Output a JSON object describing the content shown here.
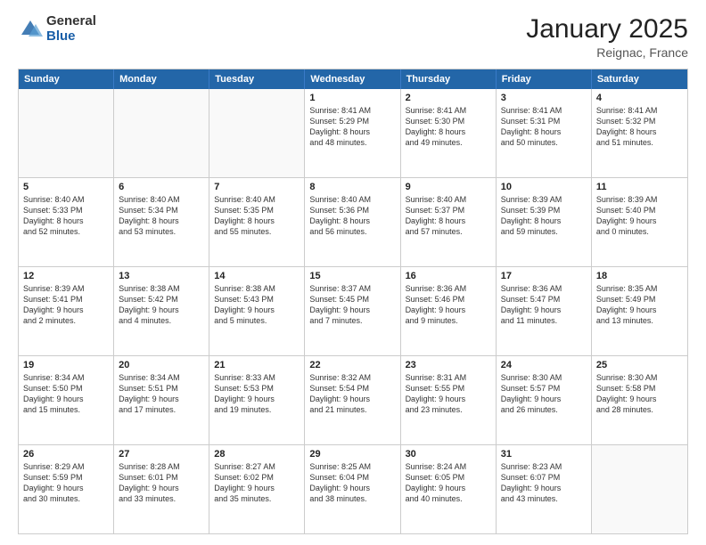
{
  "logo": {
    "general": "General",
    "blue": "Blue"
  },
  "title": "January 2025",
  "location": "Reignac, France",
  "days": [
    "Sunday",
    "Monday",
    "Tuesday",
    "Wednesday",
    "Thursday",
    "Friday",
    "Saturday"
  ],
  "weeks": [
    [
      {
        "day": "",
        "content": ""
      },
      {
        "day": "",
        "content": ""
      },
      {
        "day": "",
        "content": ""
      },
      {
        "day": "1",
        "content": "Sunrise: 8:41 AM\nSunset: 5:29 PM\nDaylight: 8 hours\nand 48 minutes."
      },
      {
        "day": "2",
        "content": "Sunrise: 8:41 AM\nSunset: 5:30 PM\nDaylight: 8 hours\nand 49 minutes."
      },
      {
        "day": "3",
        "content": "Sunrise: 8:41 AM\nSunset: 5:31 PM\nDaylight: 8 hours\nand 50 minutes."
      },
      {
        "day": "4",
        "content": "Sunrise: 8:41 AM\nSunset: 5:32 PM\nDaylight: 8 hours\nand 51 minutes."
      }
    ],
    [
      {
        "day": "5",
        "content": "Sunrise: 8:40 AM\nSunset: 5:33 PM\nDaylight: 8 hours\nand 52 minutes."
      },
      {
        "day": "6",
        "content": "Sunrise: 8:40 AM\nSunset: 5:34 PM\nDaylight: 8 hours\nand 53 minutes."
      },
      {
        "day": "7",
        "content": "Sunrise: 8:40 AM\nSunset: 5:35 PM\nDaylight: 8 hours\nand 55 minutes."
      },
      {
        "day": "8",
        "content": "Sunrise: 8:40 AM\nSunset: 5:36 PM\nDaylight: 8 hours\nand 56 minutes."
      },
      {
        "day": "9",
        "content": "Sunrise: 8:40 AM\nSunset: 5:37 PM\nDaylight: 8 hours\nand 57 minutes."
      },
      {
        "day": "10",
        "content": "Sunrise: 8:39 AM\nSunset: 5:39 PM\nDaylight: 8 hours\nand 59 minutes."
      },
      {
        "day": "11",
        "content": "Sunrise: 8:39 AM\nSunset: 5:40 PM\nDaylight: 9 hours\nand 0 minutes."
      }
    ],
    [
      {
        "day": "12",
        "content": "Sunrise: 8:39 AM\nSunset: 5:41 PM\nDaylight: 9 hours\nand 2 minutes."
      },
      {
        "day": "13",
        "content": "Sunrise: 8:38 AM\nSunset: 5:42 PM\nDaylight: 9 hours\nand 4 minutes."
      },
      {
        "day": "14",
        "content": "Sunrise: 8:38 AM\nSunset: 5:43 PM\nDaylight: 9 hours\nand 5 minutes."
      },
      {
        "day": "15",
        "content": "Sunrise: 8:37 AM\nSunset: 5:45 PM\nDaylight: 9 hours\nand 7 minutes."
      },
      {
        "day": "16",
        "content": "Sunrise: 8:36 AM\nSunset: 5:46 PM\nDaylight: 9 hours\nand 9 minutes."
      },
      {
        "day": "17",
        "content": "Sunrise: 8:36 AM\nSunset: 5:47 PM\nDaylight: 9 hours\nand 11 minutes."
      },
      {
        "day": "18",
        "content": "Sunrise: 8:35 AM\nSunset: 5:49 PM\nDaylight: 9 hours\nand 13 minutes."
      }
    ],
    [
      {
        "day": "19",
        "content": "Sunrise: 8:34 AM\nSunset: 5:50 PM\nDaylight: 9 hours\nand 15 minutes."
      },
      {
        "day": "20",
        "content": "Sunrise: 8:34 AM\nSunset: 5:51 PM\nDaylight: 9 hours\nand 17 minutes."
      },
      {
        "day": "21",
        "content": "Sunrise: 8:33 AM\nSunset: 5:53 PM\nDaylight: 9 hours\nand 19 minutes."
      },
      {
        "day": "22",
        "content": "Sunrise: 8:32 AM\nSunset: 5:54 PM\nDaylight: 9 hours\nand 21 minutes."
      },
      {
        "day": "23",
        "content": "Sunrise: 8:31 AM\nSunset: 5:55 PM\nDaylight: 9 hours\nand 23 minutes."
      },
      {
        "day": "24",
        "content": "Sunrise: 8:30 AM\nSunset: 5:57 PM\nDaylight: 9 hours\nand 26 minutes."
      },
      {
        "day": "25",
        "content": "Sunrise: 8:30 AM\nSunset: 5:58 PM\nDaylight: 9 hours\nand 28 minutes."
      }
    ],
    [
      {
        "day": "26",
        "content": "Sunrise: 8:29 AM\nSunset: 5:59 PM\nDaylight: 9 hours\nand 30 minutes."
      },
      {
        "day": "27",
        "content": "Sunrise: 8:28 AM\nSunset: 6:01 PM\nDaylight: 9 hours\nand 33 minutes."
      },
      {
        "day": "28",
        "content": "Sunrise: 8:27 AM\nSunset: 6:02 PM\nDaylight: 9 hours\nand 35 minutes."
      },
      {
        "day": "29",
        "content": "Sunrise: 8:25 AM\nSunset: 6:04 PM\nDaylight: 9 hours\nand 38 minutes."
      },
      {
        "day": "30",
        "content": "Sunrise: 8:24 AM\nSunset: 6:05 PM\nDaylight: 9 hours\nand 40 minutes."
      },
      {
        "day": "31",
        "content": "Sunrise: 8:23 AM\nSunset: 6:07 PM\nDaylight: 9 hours\nand 43 minutes."
      },
      {
        "day": "",
        "content": ""
      }
    ]
  ]
}
